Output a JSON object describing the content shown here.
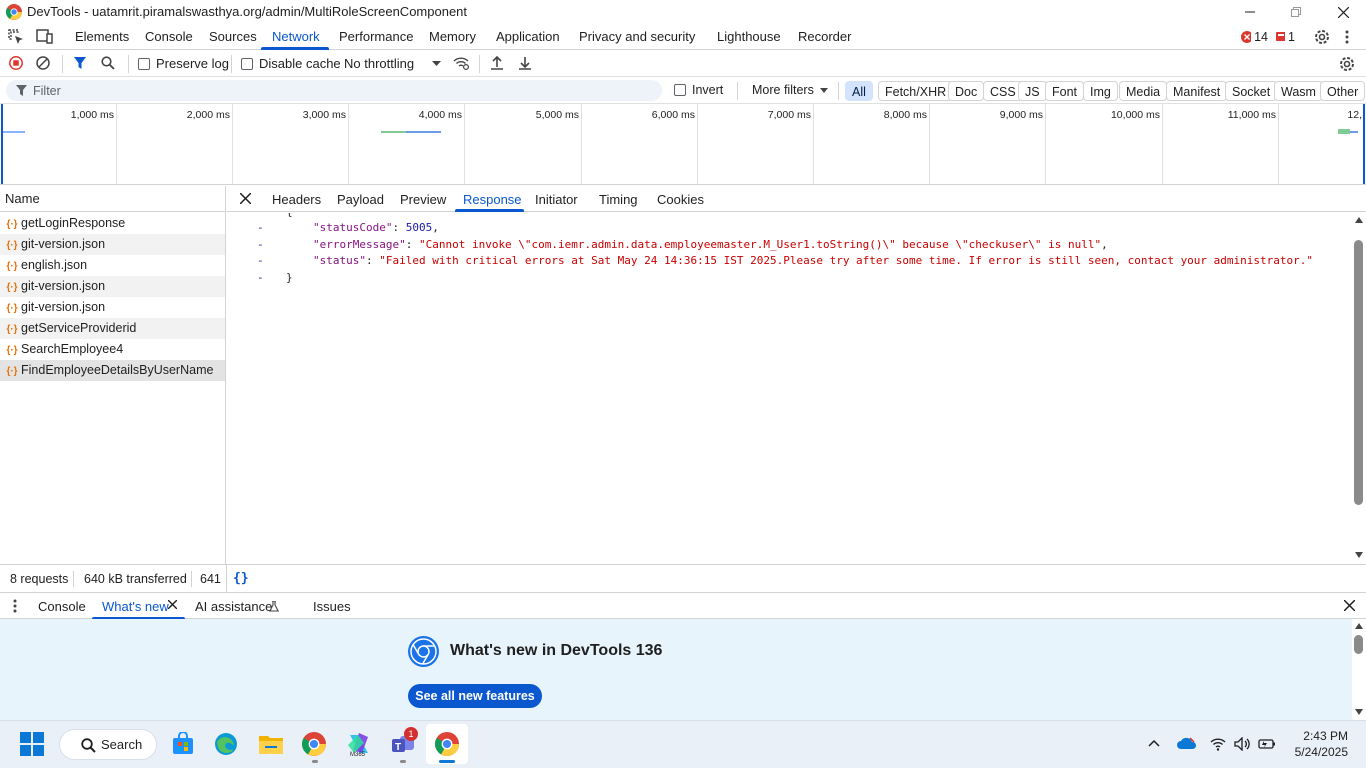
{
  "window": {
    "title": "DevTools - uatamrit.piramalswasthya.org/admin/MultiRoleScreenComponent"
  },
  "main_tabs": [
    {
      "label": "Elements"
    },
    {
      "label": "Console"
    },
    {
      "label": "Sources"
    },
    {
      "label": "Network"
    },
    {
      "label": "Performance"
    },
    {
      "label": "Memory"
    },
    {
      "label": "Application"
    },
    {
      "label": "Privacy and security"
    },
    {
      "label": "Lighthouse"
    },
    {
      "label": "Recorder"
    }
  ],
  "badges": {
    "errors": "14",
    "issues": "1"
  },
  "toolbar": {
    "preserve_log": "Preserve log",
    "disable_cache": "Disable cache",
    "throttling": "No throttling"
  },
  "filterbar": {
    "placeholder": "Filter",
    "invert": "Invert",
    "more_filters": "More filters",
    "chips": [
      "All",
      "Fetch/XHR",
      "Doc",
      "CSS",
      "JS",
      "Font",
      "Img",
      "Media",
      "Manifest",
      "Socket",
      "Wasm",
      "Other"
    ]
  },
  "timeline": {
    "labels": [
      "1,000 ms",
      "2,000 ms",
      "3,000 ms",
      "4,000 ms",
      "5,000 ms",
      "6,000 ms",
      "7,000 ms",
      "8,000 ms",
      "9,000 ms",
      "10,000 ms",
      "11,000 ms",
      "12,"
    ]
  },
  "requests": {
    "header": "Name",
    "items": [
      "getLoginResponse",
      "git-version.json",
      "english.json",
      "git-version.json",
      "git-version.json",
      "getServiceProviderid",
      "SearchEmployee4",
      "FindEmployeeDetailsByUserName"
    ]
  },
  "detail_tabs": [
    "Headers",
    "Payload",
    "Preview",
    "Response",
    "Initiator",
    "Timing",
    "Cookies"
  ],
  "response": {
    "open_brace": "{",
    "status_code_key": "\"statusCode\"",
    "status_code_value": "5005",
    "error_key": "\"errorMessage\"",
    "error_value": "\"Cannot invoke \\\"com.iemr.admin.data.employeemaster.M_User1.toString()\\\" because \\\"checkuser\\\" is null\"",
    "status_key": "\"status\"",
    "status_value": "\"Failed with critical errors at Sat May 24 14:36:15 IST 2025.Please try after some time. If error is still seen, contact your administrator.\"",
    "close_brace": "}"
  },
  "statusbar": {
    "requests": "8 requests",
    "transferred": "640 kB transferred",
    "size": "641"
  },
  "drawer": {
    "tabs": [
      "Console",
      "What's new",
      "AI assistance",
      "Issues"
    ],
    "heading": "What's new in DevTools 136",
    "button": "See all new features"
  },
  "taskbar": {
    "search": "Search",
    "teams_badge": "1",
    "time": "2:43 PM",
    "date": "5/24/2025"
  }
}
